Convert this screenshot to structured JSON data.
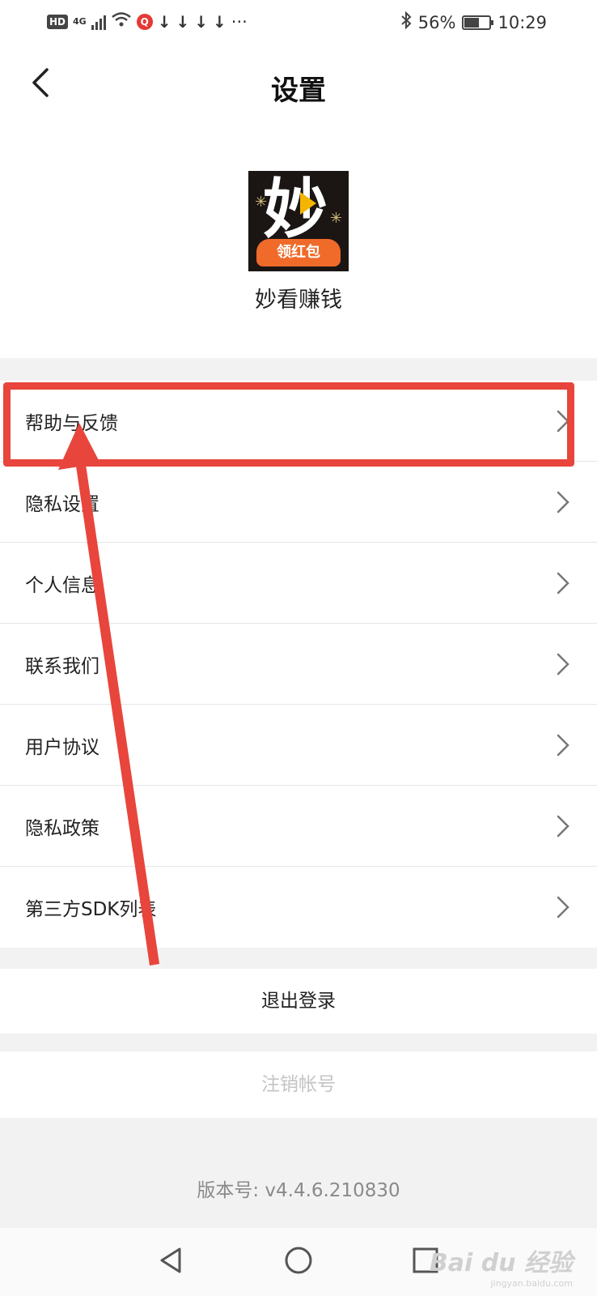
{
  "status_bar": {
    "hd": "HD",
    "signal": "4G",
    "q_badge": "Q",
    "download_icon": "↓",
    "more": "···",
    "bluetooth_icon": "bluetooth-icon",
    "battery_percent": "56%",
    "battery_level": 0.56,
    "time": "10:29"
  },
  "header": {
    "title": "设置"
  },
  "app": {
    "logo_char": "妙",
    "logo_banner": "领红包",
    "name": "妙看赚钱"
  },
  "menu": {
    "items": [
      {
        "label": "帮助与反馈"
      },
      {
        "label": "隐私设置"
      },
      {
        "label": "个人信息"
      },
      {
        "label": "联系我们"
      },
      {
        "label": "用户协议"
      },
      {
        "label": "隐私政策"
      },
      {
        "label": "第三方SDK列表"
      }
    ]
  },
  "actions": {
    "logout": "退出登录",
    "cancel_account": "注销帐号"
  },
  "version": "版本号: v4.4.6.210830",
  "watermark": {
    "brand": "Bai du 经验",
    "url": "jingyan.baidu.com"
  },
  "colors": {
    "annotation": "#e8453c",
    "logo_band": "#f06a2a"
  }
}
